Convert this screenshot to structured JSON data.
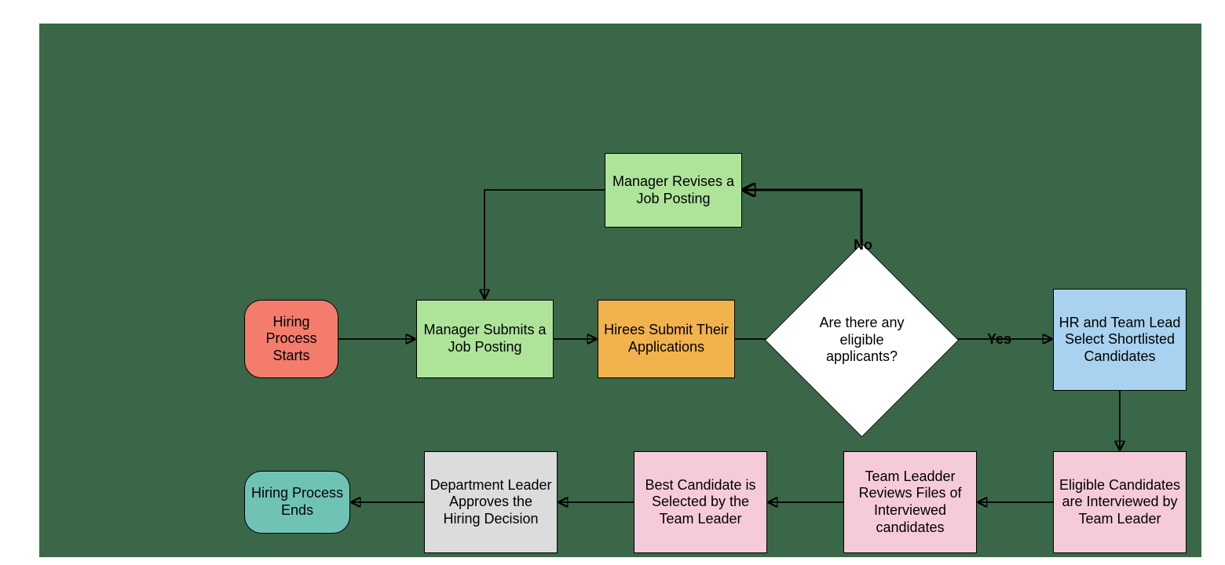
{
  "nodes": {
    "start": {
      "text": "Hiring Process Starts"
    },
    "submit": {
      "text": "Manager Submits a Job Posting"
    },
    "revise": {
      "text": "Manager Revises a Job Posting"
    },
    "applicants": {
      "text": "Hirees Submit Their Applications"
    },
    "decision": {
      "text": "Are there any eligible applicants?"
    },
    "shortlist": {
      "text": "HR and Team Lead Select Shortlisted Candidates"
    },
    "interview": {
      "text": "Eligible Candidates are Interviewed by Team Leader"
    },
    "review": {
      "text": "Team Leadder Reviews  Files of Interviewed candidates"
    },
    "select": {
      "text": "Best Candidate is Selected by the Team Leader"
    },
    "approve": {
      "text": "Department Leader Approves the Hiring Decision"
    },
    "end": {
      "text": "Hiring Process Ends"
    }
  },
  "edge_labels": {
    "no": "No",
    "yes": "Yes"
  }
}
